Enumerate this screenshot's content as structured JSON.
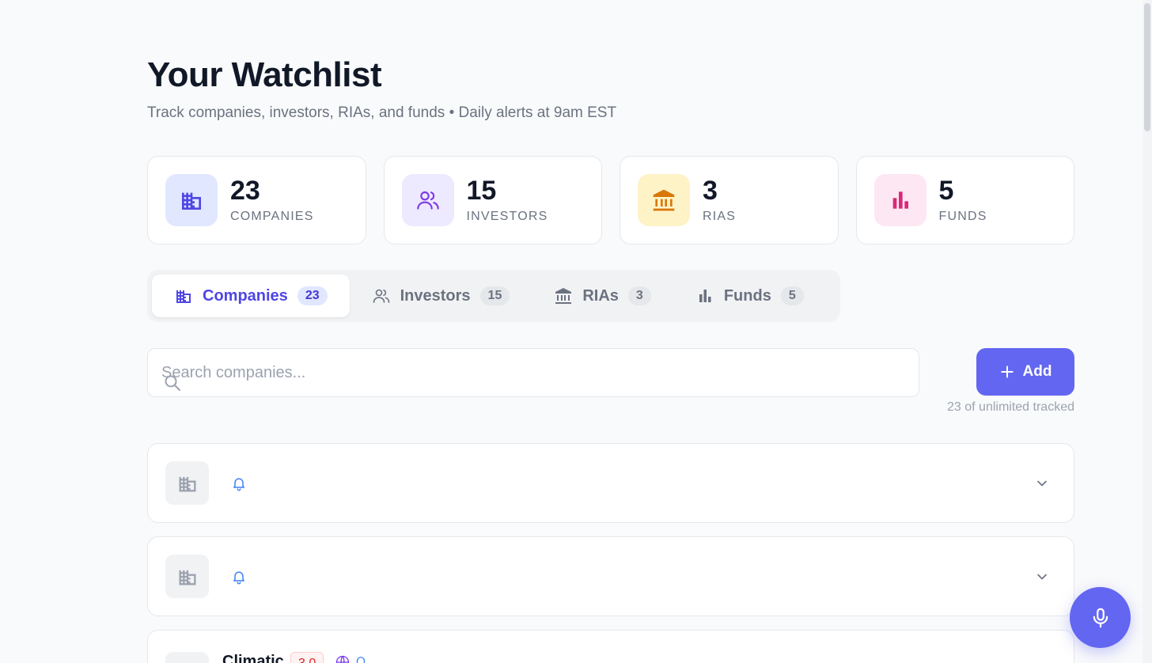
{
  "header": {
    "title": "Your Watchlist",
    "subtitle": "Track companies, investors, RIAs, and funds • Daily alerts at 9am EST"
  },
  "stats": [
    {
      "value": "23",
      "label": "COMPANIES",
      "icon": "building-icon",
      "color": "#4f46e5",
      "bg": "#e0e7ff"
    },
    {
      "value": "15",
      "label": "INVESTORS",
      "icon": "users-icon",
      "color": "#7c3aed",
      "bg": "#ede9fe"
    },
    {
      "value": "3",
      "label": "RIAS",
      "icon": "bank-icon",
      "color": "#d97706",
      "bg": "#fef3c7"
    },
    {
      "value": "5",
      "label": "FUNDS",
      "icon": "bar-chart-icon",
      "color": "#db2777",
      "bg": "#fce7f3"
    }
  ],
  "tabs": [
    {
      "label": "Companies",
      "count": "23",
      "icon": "building-icon",
      "active": true
    },
    {
      "label": "Investors",
      "count": "15",
      "icon": "users-icon",
      "active": false
    },
    {
      "label": "RIAs",
      "count": "3",
      "icon": "bank-icon",
      "active": false
    },
    {
      "label": "Funds",
      "count": "5",
      "icon": "bar-chart-icon",
      "active": false
    }
  ],
  "search": {
    "placeholder": "Search companies...",
    "value": ""
  },
  "add_button": {
    "label": "Add"
  },
  "tracked_note": "23 of unlimited tracked",
  "list": {
    "partial_item": {
      "name": "Climatic",
      "score": "3.0"
    }
  },
  "colors": {
    "accent": "#6366f1",
    "accent_text": "#4f46e5",
    "score_red": "#dc2626"
  }
}
